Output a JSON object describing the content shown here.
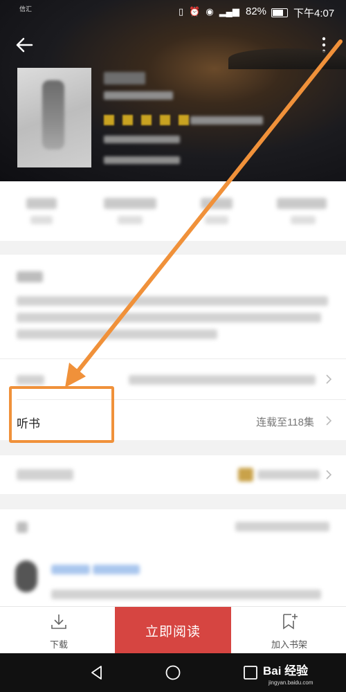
{
  "status_bar": {
    "carrier": "信汇",
    "battery": "82%",
    "time": "下午4:07"
  },
  "listen_row": {
    "label": "听书",
    "value": "连载至118集"
  },
  "bottom_bar": {
    "download_label": "下载",
    "read_label": "立即阅读",
    "shelf_label": "加入书架"
  },
  "watermark": {
    "brand": "Bai 经验",
    "url": "jingyan.baidu.com"
  },
  "colors": {
    "read_button": "#d64541",
    "annotation": "#f0913a",
    "page_gap": "#f2f2f2"
  },
  "icons": [
    "back-arrow-icon",
    "more-icon",
    "chevron-right-icon",
    "download-icon",
    "bookmark-add-icon",
    "back-nav-icon",
    "home-nav-icon",
    "recents-nav-icon"
  ]
}
